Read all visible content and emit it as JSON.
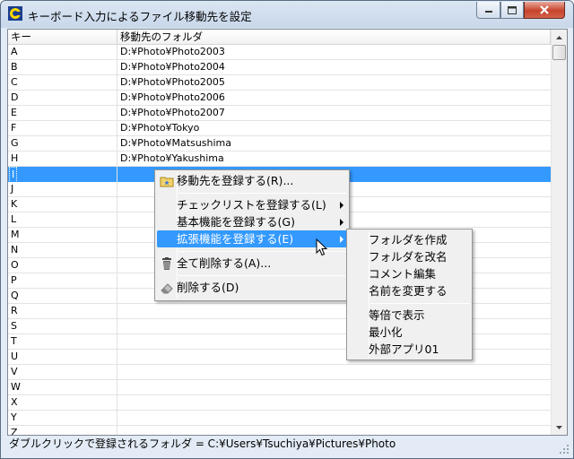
{
  "window": {
    "title": "キーボード入力によるファイル移動先を設定",
    "app_icon": "app-icon",
    "buttons": [
      "minimize-icon",
      "maximize-icon",
      "close-icon"
    ]
  },
  "list": {
    "columns": [
      "キー",
      "移動先のフォルダ"
    ],
    "selected_row": 8,
    "rows": [
      {
        "key": "A",
        "folder": "D:¥Photo¥Photo2003"
      },
      {
        "key": "B",
        "folder": "D:¥Photo¥Photo2004"
      },
      {
        "key": "C",
        "folder": "D:¥Photo¥Photo2005"
      },
      {
        "key": "D",
        "folder": "D:¥Photo¥Photo2006"
      },
      {
        "key": "E",
        "folder": "D:¥Photo¥Photo2007"
      },
      {
        "key": "F",
        "folder": "D:¥Photo¥Tokyo"
      },
      {
        "key": "G",
        "folder": "D:¥Photo¥Matsushima"
      },
      {
        "key": "H",
        "folder": "D:¥Photo¥Yakushima"
      },
      {
        "key": "I",
        "folder": ""
      },
      {
        "key": "J",
        "folder": ""
      },
      {
        "key": "K",
        "folder": ""
      },
      {
        "key": "L",
        "folder": ""
      },
      {
        "key": "M",
        "folder": ""
      },
      {
        "key": "N",
        "folder": ""
      },
      {
        "key": "O",
        "folder": ""
      },
      {
        "key": "P",
        "folder": ""
      },
      {
        "key": "Q",
        "folder": ""
      },
      {
        "key": "R",
        "folder": ""
      },
      {
        "key": "S",
        "folder": ""
      },
      {
        "key": "T",
        "folder": ""
      },
      {
        "key": "U",
        "folder": ""
      },
      {
        "key": "V",
        "folder": ""
      },
      {
        "key": "W",
        "folder": ""
      },
      {
        "key": "X",
        "folder": ""
      },
      {
        "key": "Y",
        "folder": ""
      },
      {
        "key": "Z",
        "folder": ""
      }
    ]
  },
  "context_menu": {
    "register_dest": "移動先を登録する(R)...",
    "register_checklist": "チェックリストを登録する(L)",
    "register_basic": "基本機能を登録する(G)",
    "register_extended": "拡張機能を登録する(E)",
    "delete_all": "全て削除する(A)...",
    "delete": "削除する(D)"
  },
  "submenu": {
    "items_group1": [
      "フォルダを作成",
      "フォルダを改名",
      "コメント編集",
      "名前を変更する"
    ],
    "items_group2": [
      "等倍で表示",
      "最小化",
      "外部アプリ01"
    ]
  },
  "status": {
    "text": "ダブルクリックで登録されるフォルダ = C:¥Users¥Tsuchiya¥Pictures¥Photo"
  },
  "colors": {
    "selection": "#3399ff",
    "window_frame": "#e3ecf6"
  }
}
